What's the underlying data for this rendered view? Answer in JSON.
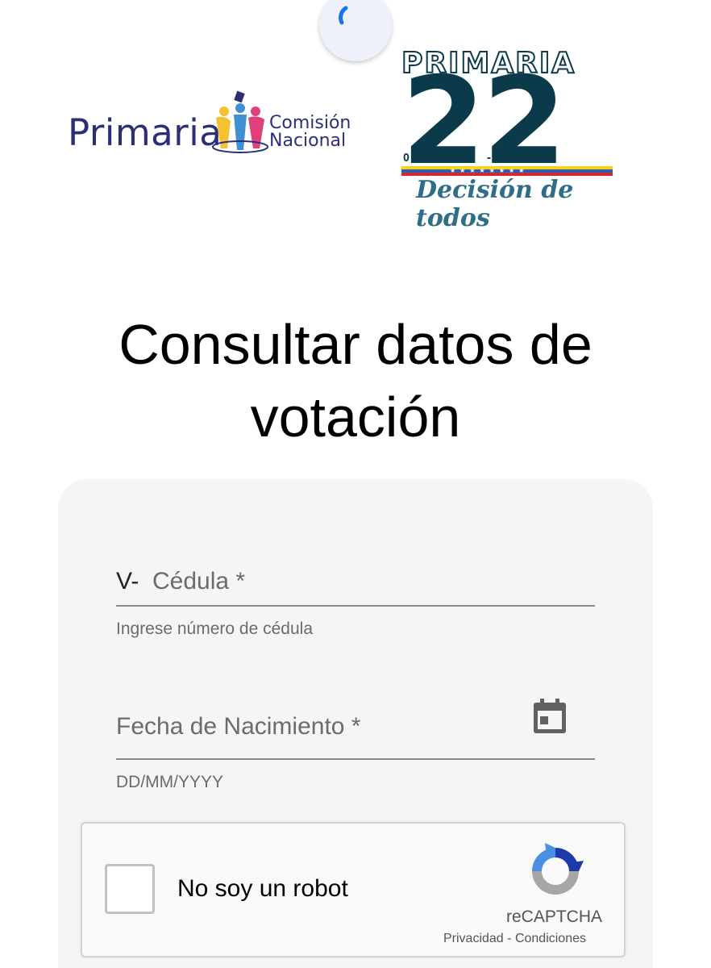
{
  "logos": {
    "left": {
      "word": "Primaria",
      "sub_line1": "Comisión",
      "sub_line2": "Nacional"
    },
    "right": {
      "top_word": "PRIMARIA",
      "number": "22",
      "date": "OCTUBRE - 2023",
      "slogan": "Decisión de todos"
    }
  },
  "title": {
    "line1": "Consultar datos de",
    "line2": "votación"
  },
  "form": {
    "cedula": {
      "prefix": "V-",
      "label": "Cédula *",
      "hint": "Ingrese número de cédula"
    },
    "fecha": {
      "label": "Fecha de Nacimiento *",
      "hint": "DD/MM/YYYY"
    }
  },
  "captcha": {
    "text": "No soy un robot",
    "brand": "reCAPTCHA",
    "privacy": "Privacidad",
    "separator": "-",
    "terms": "Condiciones"
  },
  "colors": {
    "logo_navy": "#2c2f78",
    "logo_teal": "#0b3b4a",
    "card_bg": "#f5f5f5",
    "spinner_blue": "#1a73e8"
  },
  "icons": [
    "spinner-icon",
    "people-icon",
    "calendar-icon",
    "recaptcha-icon"
  ]
}
